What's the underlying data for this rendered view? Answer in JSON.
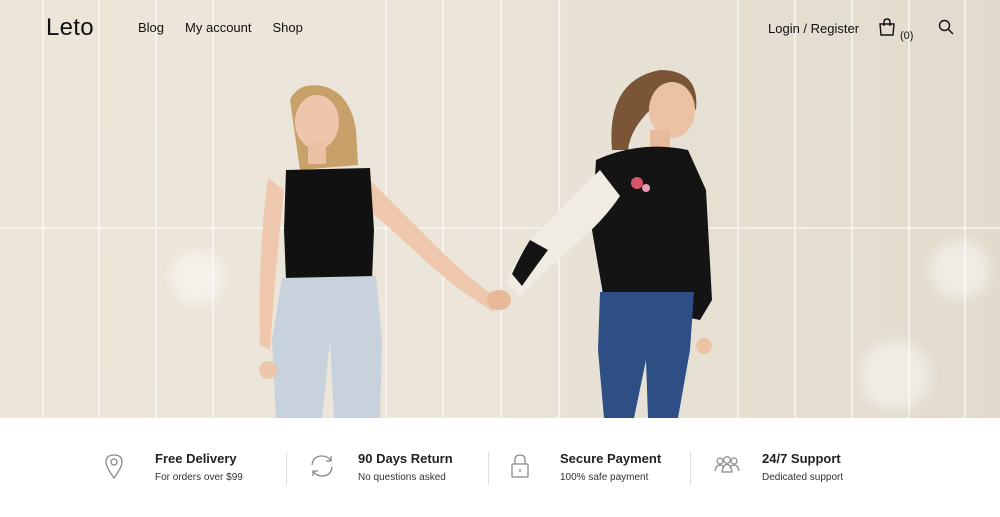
{
  "header": {
    "logo": "Leto",
    "menu": [
      "Blog",
      "My account",
      "Shop"
    ],
    "login_label": "Login / Register",
    "cart_count": "(0)"
  },
  "features": [
    {
      "title": "Free Delivery",
      "subtitle": "For orders over $99",
      "icon": "map-pin-icon"
    },
    {
      "title": "90 Days Return",
      "subtitle": "No questions asked",
      "icon": "refresh-icon"
    },
    {
      "title": "Secure Payment",
      "subtitle": "100% safe payment",
      "icon": "lock-icon"
    },
    {
      "title": "24/7 Support",
      "subtitle": "Dedicated support",
      "icon": "users-icon"
    }
  ],
  "colors": {
    "wall": "#ebe5da",
    "text": "#111111",
    "divider": "#dddddd",
    "jacket": "#141414",
    "jeans": "#2d4f86"
  }
}
